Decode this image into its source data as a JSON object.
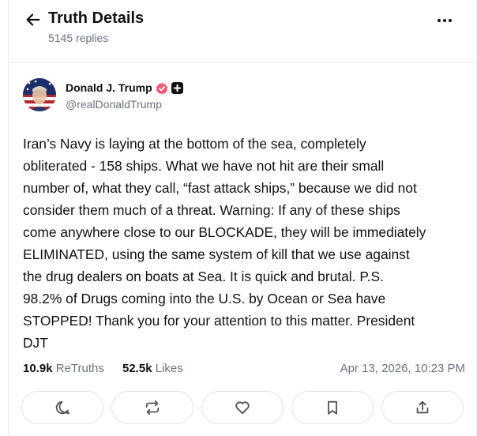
{
  "header": {
    "title": "Truth Details",
    "replies": "5145 replies",
    "back_icon": "arrow-left-icon",
    "more_icon": "more-horizontal-icon"
  },
  "author": {
    "name": "Donald J. Trump",
    "handle": "@realDonaldTrump",
    "verified_badge_color": "#f0587a",
    "plus_badge_color": "#111111"
  },
  "post": {
    "text": "Iran’s Navy is laying at the bottom of the sea, completely\nobliterated - 158 ships. What we have not hit are their small\nnumber of, what they call, “fast attack ships,” because we did not\nconsider them much of a threat. Warning: If any of these ships\ncome anywhere close to our BLOCKADE, they will be immediately\nELIMINATED, using the same system of kill that we use against\nthe drug dealers on boats at Sea. It is quick and brutal. P.S.\n98.2% of Drugs coming into the U.S. by Ocean or Sea have\nSTOPPED! Thank you for your attention to this matter. President\nDJT"
  },
  "stats": {
    "retruths_count": "10.9k",
    "retruths_label": "ReTruths",
    "likes_count": "52.5k",
    "likes_label": "Likes",
    "timestamp": "Apr 13, 2026, 10:23 PM"
  },
  "actions": [
    {
      "icon": "comment-icon"
    },
    {
      "icon": "retruth-icon"
    },
    {
      "icon": "heart-icon"
    },
    {
      "icon": "bookmark-icon"
    },
    {
      "icon": "share-icon"
    }
  ],
  "colors": {
    "text": "#111111",
    "muted": "#6b7280",
    "border": "#e3e3e3"
  }
}
